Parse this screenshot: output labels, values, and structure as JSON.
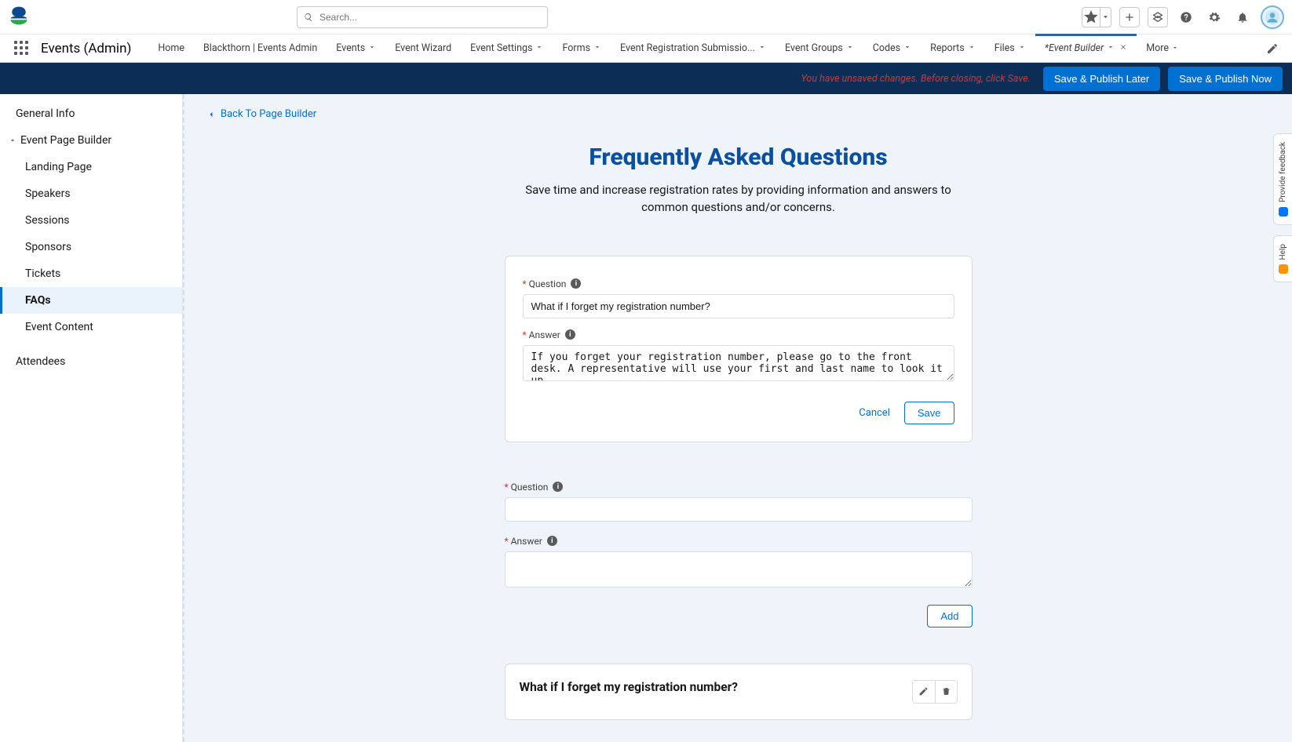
{
  "header": {
    "search_placeholder": "Search..."
  },
  "nav": {
    "app_name": "Events (Admin)",
    "tabs": [
      {
        "label": "Home",
        "dropdown": false
      },
      {
        "label": "Blackthorn | Events Admin",
        "dropdown": false
      },
      {
        "label": "Events",
        "dropdown": true
      },
      {
        "label": "Event Wizard",
        "dropdown": false
      },
      {
        "label": "Event Settings",
        "dropdown": true
      },
      {
        "label": "Forms",
        "dropdown": true
      },
      {
        "label": "Event Registration Submissio...",
        "dropdown": true
      },
      {
        "label": "Event Groups",
        "dropdown": true
      },
      {
        "label": "Codes",
        "dropdown": true
      },
      {
        "label": "Reports",
        "dropdown": true
      },
      {
        "label": "Files",
        "dropdown": true
      }
    ],
    "active_tab": {
      "label": "Event Builder",
      "prefix": "* "
    },
    "more_label": "More"
  },
  "action_bar": {
    "warning": "You have unsaved changes. Before closing, click Save.",
    "save_later": "Save & Publish Later",
    "save_now": "Save & Publish Now"
  },
  "sidebar": {
    "general_info": "General Info",
    "page_builder": "Event Page Builder",
    "subs": {
      "landing": "Landing Page",
      "speakers": "Speakers",
      "sessions": "Sessions",
      "sponsors": "Sponsors",
      "tickets": "Tickets",
      "faqs": "FAQs",
      "content": "Event Content"
    },
    "attendees": "Attendees"
  },
  "main": {
    "back_link": "Back To Page Builder",
    "title": "Frequently Asked Questions",
    "subtitle": "Save time and increase registration rates by providing information and answers to common questions and/or concerns.",
    "labels": {
      "question": "Question",
      "answer": "Answer"
    },
    "edit_card": {
      "question_value": "What if I forget my registration number?",
      "answer_value": "If you forget your registration number, please go to the front desk. A representative will use your first and last name to look it up.",
      "cancel": "Cancel",
      "save": "Save"
    },
    "new_form": {
      "question_value": "",
      "answer_value": "",
      "add": "Add"
    },
    "existing": {
      "question": "What if I forget my registration number?"
    }
  },
  "feedback": {
    "provide": "Provide feedback",
    "help": "Help"
  }
}
